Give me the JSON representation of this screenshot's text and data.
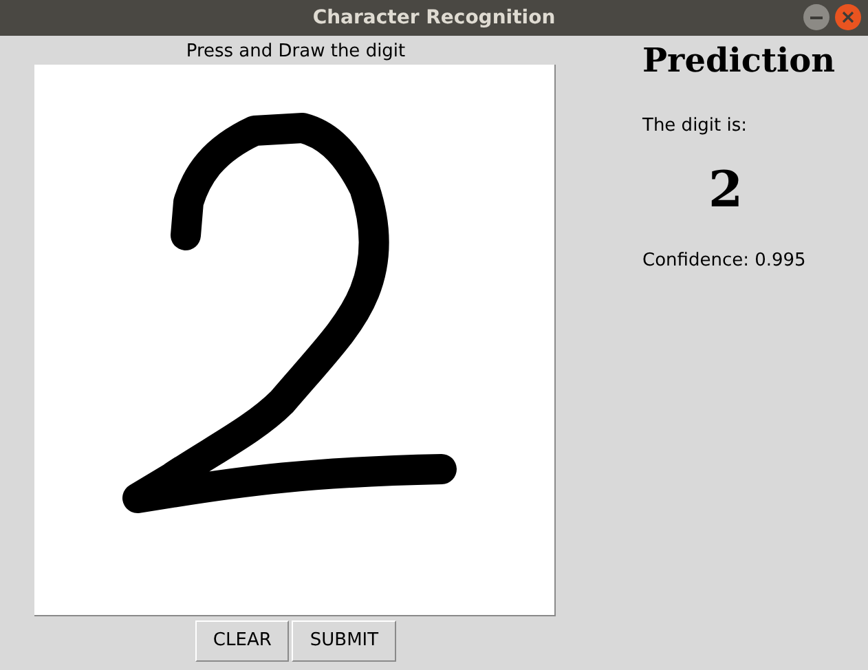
{
  "window": {
    "title": "Character Recognition"
  },
  "canvas": {
    "label": "Press and Draw the digit"
  },
  "buttons": [
    "CLEAR",
    "SUBMIT"
  ],
  "prediction": {
    "heading": "Prediction",
    "intro": "The digit is:",
    "digit": "2",
    "confidence": "Confidence: 0.995"
  }
}
